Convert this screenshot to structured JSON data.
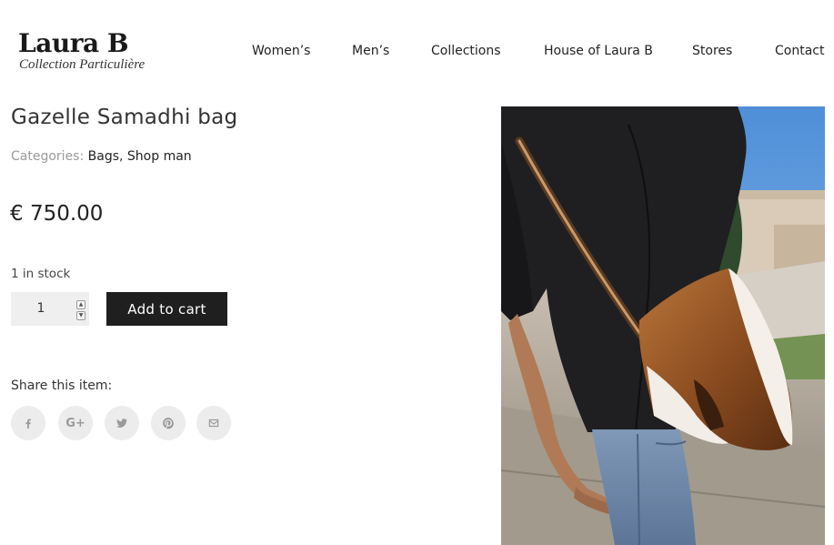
{
  "header": {
    "logo_name": "Laura B",
    "logo_tagline": "Collection Particulière",
    "nav": [
      {
        "label": "Women’s"
      },
      {
        "label": "Men’s"
      },
      {
        "label": "Collections"
      },
      {
        "label": "House of Laura B"
      },
      {
        "label": "Stores"
      },
      {
        "label": "Contact"
      }
    ]
  },
  "product": {
    "title": "Gazelle Samadhi bag",
    "categories_label": "Categories:",
    "categories": [
      "Bags",
      "Shop man"
    ],
    "category_separator": ",",
    "price": "€ 750.00",
    "stock": "1 in stock",
    "quantity": "1",
    "add_to_cart_label": "Add to cart",
    "image_icon": "product-photo-man-with-fur-crossbody-bag"
  },
  "share": {
    "title": "Share this item:",
    "icons": [
      "facebook-icon",
      "google-plus-icon",
      "twitter-icon",
      "pinterest-icon",
      "email-icon"
    ],
    "icon_color": "#9a9a9a",
    "icon_bg": "#ececec"
  },
  "colors": {
    "button_bg": "#1f1f1f",
    "category_label": "#999999",
    "sky": "#6ea8e0"
  }
}
